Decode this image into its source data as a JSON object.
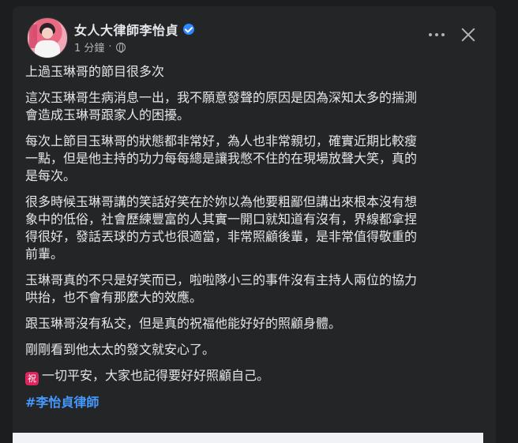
{
  "post": {
    "page_name": "女人大律師李怡貞",
    "timestamp": "1 分鐘",
    "separator": "·",
    "paragraphs": [
      "上過玉琳哥的節目很多次",
      "這次玉琳哥生病消息一出，我不願意發聲的原因是因為深知太多的揣測\n會造成玉琳哥跟家人的困擾。",
      "每次上節目玉琳哥的狀態都非常好，為人也非常親切，確實近期比較瘦\n一點，但是他主持的功力每每總是讓我憋不住的在現場放聲大笑，真的\n是每次。",
      "很多時候玉琳哥講的笑話好笑在於妳以為他要粗鄙但講出來根本沒有想\n象中的低俗，社會歷練豐富的人其實一開口就知道有沒有，界線都拿捏\n得很好，發話丟球的方式也很適當，非常照顧後輩，是非常值得敬重的\n前輩。",
      "玉琳哥真的不只是好笑而已，啦啦隊小三的事件沒有主持人兩位的協力\n哄抬，也不會有那麼大的效應。",
      "跟玉琳哥沒有私交，但是真的祝福他能好好的照顧身體。",
      "剛剛看到他太太的發文就安心了。"
    ],
    "closing": {
      "emoji": "祝",
      "text": "一切平安，大家也記得要好好照顧自己。"
    },
    "hashtag": "#李怡貞律師"
  },
  "icons": {
    "verified": "verified-badge-icon",
    "privacy": "globe-icon",
    "more": "more-options-icon",
    "close": "close-icon"
  },
  "colors": {
    "background": "#242526",
    "text": "#e4e6eb",
    "secondary_text": "#b0b3b8",
    "hashtag": "#4599ff",
    "verified": "#2d88ff",
    "emoji_badge": "#e0245e"
  }
}
